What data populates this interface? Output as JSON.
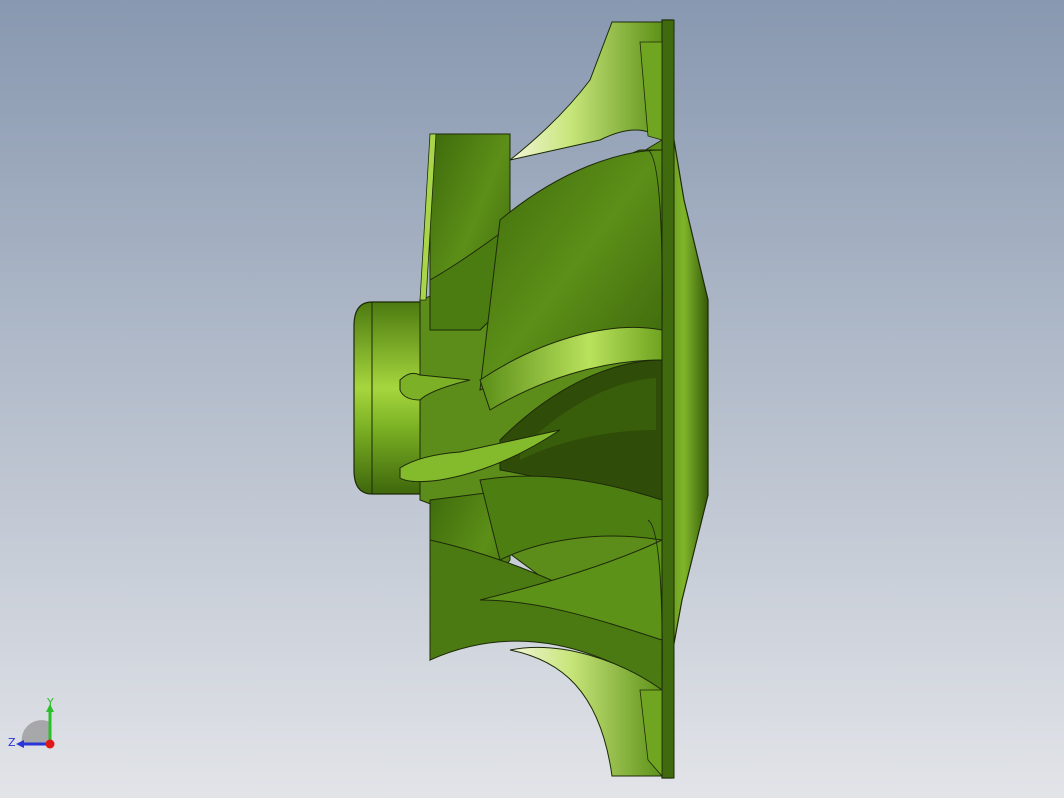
{
  "viewport": {
    "background_top": "#8a9bb2",
    "background_bottom": "#dfe2e6"
  },
  "model": {
    "name": "impeller",
    "base_color": "#4f7d12",
    "highlight_color": "#b8e05a",
    "shadow_color": "#2e4a08",
    "edge_color": "#1d2a08"
  },
  "triad": {
    "y_label": "Y",
    "z_label": "Z",
    "y_color": "#2bbf2b",
    "z_color": "#2a35d8",
    "x_color": "#e01818"
  }
}
